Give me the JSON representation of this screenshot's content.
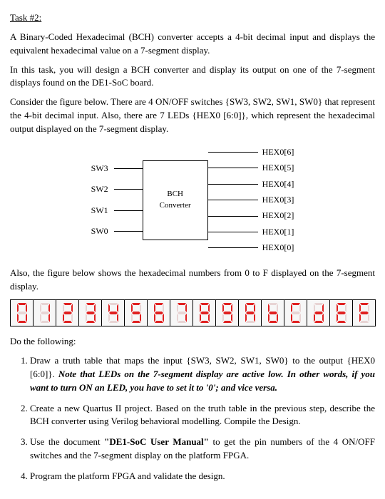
{
  "title": "Task #2:",
  "para1": "A Binary-Coded Hexadecimal (BCH) converter accepts a 4-bit decimal input and displays the equivalent hexadecimal value on a 7-segment display.",
  "para2": "In this task, you will design a BCH converter and display its output on one of the 7-segment displays found on the DE1-SoC board.",
  "para3": "Consider the figure below. There are 4 ON/OFF switches {SW3, SW2, SW1, SW0} that represent the 4-bit decimal input. Also, there are 7 LEDs {HEX0 [6:0]}, which represent the hexadecimal output displayed on the 7-segment display.",
  "diagram": {
    "inputs": [
      "SW3",
      "SW2",
      "SW1",
      "SW0"
    ],
    "box_line1": "BCH",
    "box_line2": "Converter",
    "outputs": [
      "HEX0[6]",
      "HEX0[5]",
      "HEX0[4]",
      "HEX0[3]",
      "HEX0[2]",
      "HEX0[1]",
      "HEX0[0]"
    ]
  },
  "para4": "Also, the figure below shows the hexadecimal numbers from 0 to F displayed on the 7-segment display.",
  "seven_seg": {
    "values": [
      "0",
      "1",
      "2",
      "3",
      "4",
      "5",
      "6",
      "7",
      "8",
      "9",
      "A",
      "b",
      "C",
      "d",
      "E",
      "F"
    ],
    "patterns": {
      "0": [
        1,
        1,
        1,
        1,
        1,
        1,
        0
      ],
      "1": [
        0,
        1,
        1,
        0,
        0,
        0,
        0
      ],
      "2": [
        1,
        1,
        0,
        1,
        1,
        0,
        1
      ],
      "3": [
        1,
        1,
        1,
        1,
        0,
        0,
        1
      ],
      "4": [
        0,
        1,
        1,
        0,
        0,
        1,
        1
      ],
      "5": [
        1,
        0,
        1,
        1,
        0,
        1,
        1
      ],
      "6": [
        1,
        0,
        1,
        1,
        1,
        1,
        1
      ],
      "7": [
        1,
        1,
        1,
        0,
        0,
        0,
        0
      ],
      "8": [
        1,
        1,
        1,
        1,
        1,
        1,
        1
      ],
      "9": [
        1,
        1,
        1,
        1,
        0,
        1,
        1
      ],
      "A": [
        1,
        1,
        1,
        0,
        1,
        1,
        1
      ],
      "b": [
        0,
        0,
        1,
        1,
        1,
        1,
        1
      ],
      "C": [
        1,
        0,
        0,
        1,
        1,
        1,
        0
      ],
      "d": [
        0,
        1,
        1,
        1,
        1,
        0,
        1
      ],
      "E": [
        1,
        0,
        0,
        1,
        1,
        1,
        1
      ],
      "F": [
        1,
        0,
        0,
        0,
        1,
        1,
        1
      ]
    }
  },
  "do_following": "Do the following:",
  "tasks": {
    "t1_a": "Draw a truth table that maps the input {SW3, SW2, SW1, SW0} to the output {HEX0 [6:0]}. ",
    "t1_b": "Note that LEDs on the 7-segment display are active low. In other words, if you want to turn ON an LED, you have to set it to '0'; and vice versa.",
    "t2": "Create a new Quartus II project. Based on the truth table in the previous step, describe the BCH converter using Verilog behavioral modelling. Compile the Design.",
    "t3_a": "Use the document ",
    "t3_b": "\"DE1-SoC User Manual\"",
    "t3_c": " to get the pin numbers of the 4 ON/OFF switches and the 7-segment display on the platform FPGA.",
    "t4": "Program the platform FPGA and validate the design."
  }
}
